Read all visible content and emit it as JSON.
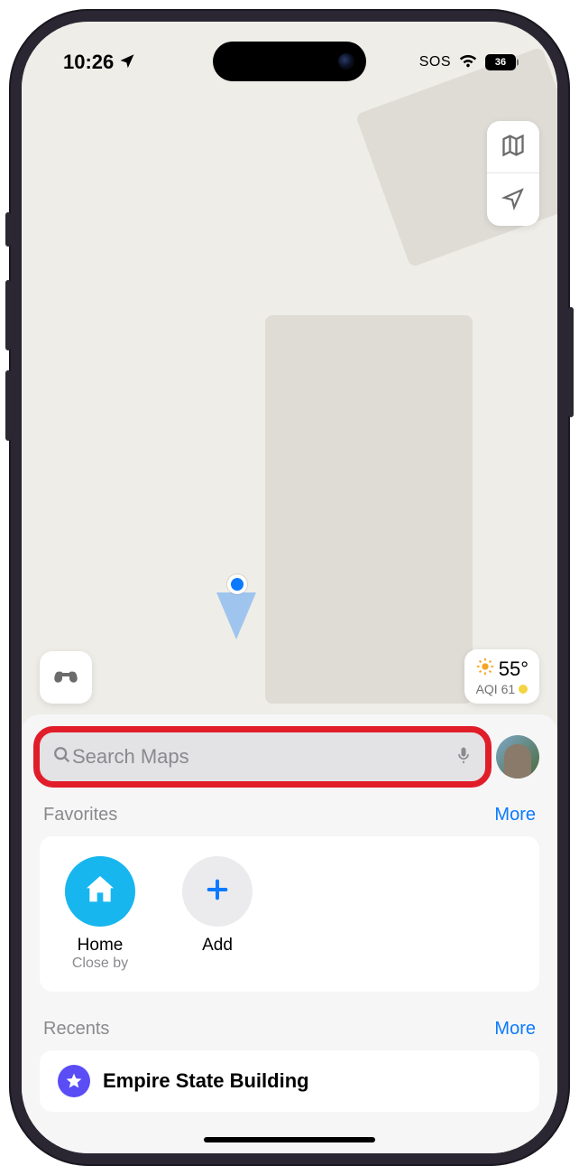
{
  "status": {
    "time": "10:26",
    "sos": "SOS",
    "battery": "36"
  },
  "weather": {
    "temp": "55°",
    "aqi_label": "AQI 61"
  },
  "search": {
    "placeholder": "Search Maps"
  },
  "favorites": {
    "title": "Favorites",
    "more": "More",
    "items": [
      {
        "label": "Home",
        "subtitle": "Close by"
      },
      {
        "label": "Add",
        "subtitle": ""
      }
    ]
  },
  "recents": {
    "title": "Recents",
    "more": "More",
    "items": [
      {
        "title": "Empire State Building"
      }
    ]
  },
  "colors": {
    "accent_blue": "#0b7aff",
    "home_teal": "#17b6ef",
    "highlight_red": "#e11d2a"
  },
  "icons": {
    "location_arrow": "location-arrow-icon",
    "wifi": "wifi-icon",
    "map_mode": "map-mode-icon",
    "nav_arrow": "navigation-arrow-icon",
    "binoculars": "binoculars-icon",
    "sun": "sun-icon",
    "search": "search-icon",
    "mic": "microphone-icon",
    "house": "house-icon",
    "plus": "plus-icon",
    "star": "star-icon"
  }
}
